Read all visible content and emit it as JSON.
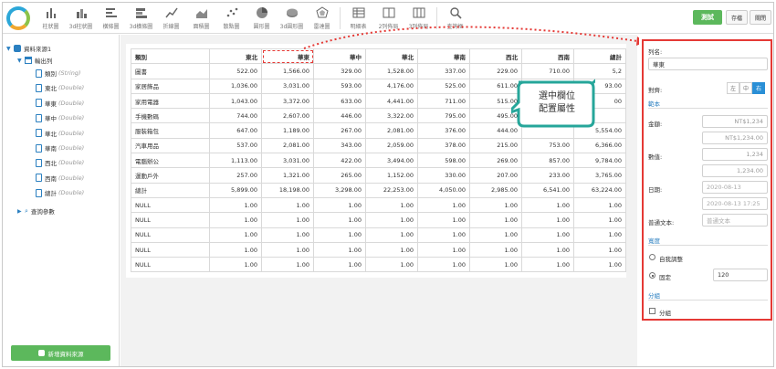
{
  "toolbar": {
    "buttons": [
      {
        "label": "柱狀圖",
        "icon": "bar-chart-icon"
      },
      {
        "label": "3d柱狀圖",
        "icon": "bar-chart-3d-icon"
      },
      {
        "label": "橫條圖",
        "icon": "horizontal-bar-icon"
      },
      {
        "label": "3d橫條圖",
        "icon": "horizontal-bar-3d-icon"
      },
      {
        "label": "折線圖",
        "icon": "line-chart-icon"
      },
      {
        "label": "面積圖",
        "icon": "area-chart-icon"
      },
      {
        "label": "散點圖",
        "icon": "scatter-chart-icon"
      },
      {
        "label": "圓形圖",
        "icon": "pie-chart-icon"
      },
      {
        "label": "3d圓形圖",
        "icon": "pie-chart-3d-icon"
      },
      {
        "label": "雷達圖",
        "icon": "radar-chart-icon"
      },
      {
        "label": "明細表",
        "icon": "detail-table-icon"
      },
      {
        "label": "2列佈局",
        "icon": "two-column-layout-icon"
      },
      {
        "label": "3列佈局",
        "icon": "three-column-layout-icon"
      },
      {
        "label": "查詢框",
        "icon": "search-icon"
      }
    ],
    "test_label": "測試",
    "save_label": "存檔",
    "close_label": "關閉"
  },
  "tree": {
    "datasource": "資料來源1",
    "output": "輸出列",
    "fields": [
      {
        "name": "類別",
        "type": "(String)"
      },
      {
        "name": "東北",
        "type": "(Double)"
      },
      {
        "name": "華東",
        "type": "(Double)"
      },
      {
        "name": "華中",
        "type": "(Double)"
      },
      {
        "name": "華北",
        "type": "(Double)"
      },
      {
        "name": "華南",
        "type": "(Double)"
      },
      {
        "name": "西北",
        "type": "(Double)"
      },
      {
        "name": "西南",
        "type": "(Double)"
      },
      {
        "name": "總計",
        "type": "(Double)"
      }
    ],
    "query_params": "查詢參數",
    "add_source_label": "新增資料來源"
  },
  "grid": {
    "headers": [
      "類別",
      "東北",
      "華東",
      "華中",
      "華北",
      "華南",
      "西北",
      "西南",
      "總計"
    ],
    "rows": [
      [
        "圖書",
        "522.00",
        "1,566.00",
        "329.00",
        "1,528.00",
        "337.00",
        "229.00",
        "710.00",
        "5,2"
      ],
      [
        "家居飾品",
        "1,036.00",
        "3,031.00",
        "593.00",
        "4,176.00",
        "525.00",
        "611.00",
        "",
        "93.00"
      ],
      [
        "家用電器",
        "1,043.00",
        "3,372.00",
        "633.00",
        "4,441.00",
        "711.00",
        "515.00",
        "",
        "00"
      ],
      [
        "手機數碼",
        "744.00",
        "2,607.00",
        "446.00",
        "3,322.00",
        "795.00",
        "495.00",
        "",
        ""
      ],
      [
        "服裝箱包",
        "647.00",
        "1,189.00",
        "267.00",
        "2,081.00",
        "376.00",
        "444.00",
        "",
        "5,554.00"
      ],
      [
        "汽車用品",
        "537.00",
        "2,081.00",
        "343.00",
        "2,059.00",
        "378.00",
        "215.00",
        "753.00",
        "6,366.00"
      ],
      [
        "電腦辦公",
        "1,113.00",
        "3,031.00",
        "422.00",
        "3,494.00",
        "598.00",
        "269.00",
        "857.00",
        "9,784.00"
      ],
      [
        "運動戶外",
        "257.00",
        "1,321.00",
        "265.00",
        "1,152.00",
        "330.00",
        "207.00",
        "233.00",
        "3,765.00"
      ],
      [
        "總計",
        "5,899.00",
        "18,198.00",
        "3,298.00",
        "22,253.00",
        "4,050.00",
        "2,985.00",
        "6,541.00",
        "63,224.00"
      ],
      [
        "NULL",
        "1.00",
        "1.00",
        "1.00",
        "1.00",
        "1.00",
        "1.00",
        "1.00",
        "1.00"
      ],
      [
        "NULL",
        "1.00",
        "1.00",
        "1.00",
        "1.00",
        "1.00",
        "1.00",
        "1.00",
        "1.00"
      ],
      [
        "NULL",
        "1.00",
        "1.00",
        "1.00",
        "1.00",
        "1.00",
        "1.00",
        "1.00",
        "1.00"
      ],
      [
        "NULL",
        "1.00",
        "1.00",
        "1.00",
        "1.00",
        "1.00",
        "1.00",
        "1.00",
        "1.00"
      ],
      [
        "NULL",
        "1.00",
        "1.00",
        "1.00",
        "1.00",
        "1.00",
        "1.00",
        "1.00",
        "1.00"
      ]
    ]
  },
  "callout": {
    "line1": "選中欄位",
    "line2": "配置屬性"
  },
  "props": {
    "column_name_label": "列名:",
    "column_name_value": "華東",
    "align_label": "對齊:",
    "align_options": [
      "左",
      "中",
      "右"
    ],
    "sample_section": "範本",
    "amount_label": "金額:",
    "amount_value1": "NT$1,234",
    "amount_value2": "NT$1,234.00",
    "number_label": "數值:",
    "number_value1": "1,234",
    "number_value2": "1,234.00",
    "date_label": "日期:",
    "date_value1": "2020-08-13",
    "date_value2": "2020-08-13 17:25",
    "text_label": "普通文本:",
    "text_value": "普通文本",
    "width_section": "寬度",
    "auto_label": "自我調整",
    "fixed_label": "固定",
    "fixed_value": "120",
    "group_section": "分組",
    "group_label": "分組"
  },
  "colors": {
    "accent": "#2a7fc0",
    "green": "#5cb85c",
    "highlight": "#e53935"
  }
}
